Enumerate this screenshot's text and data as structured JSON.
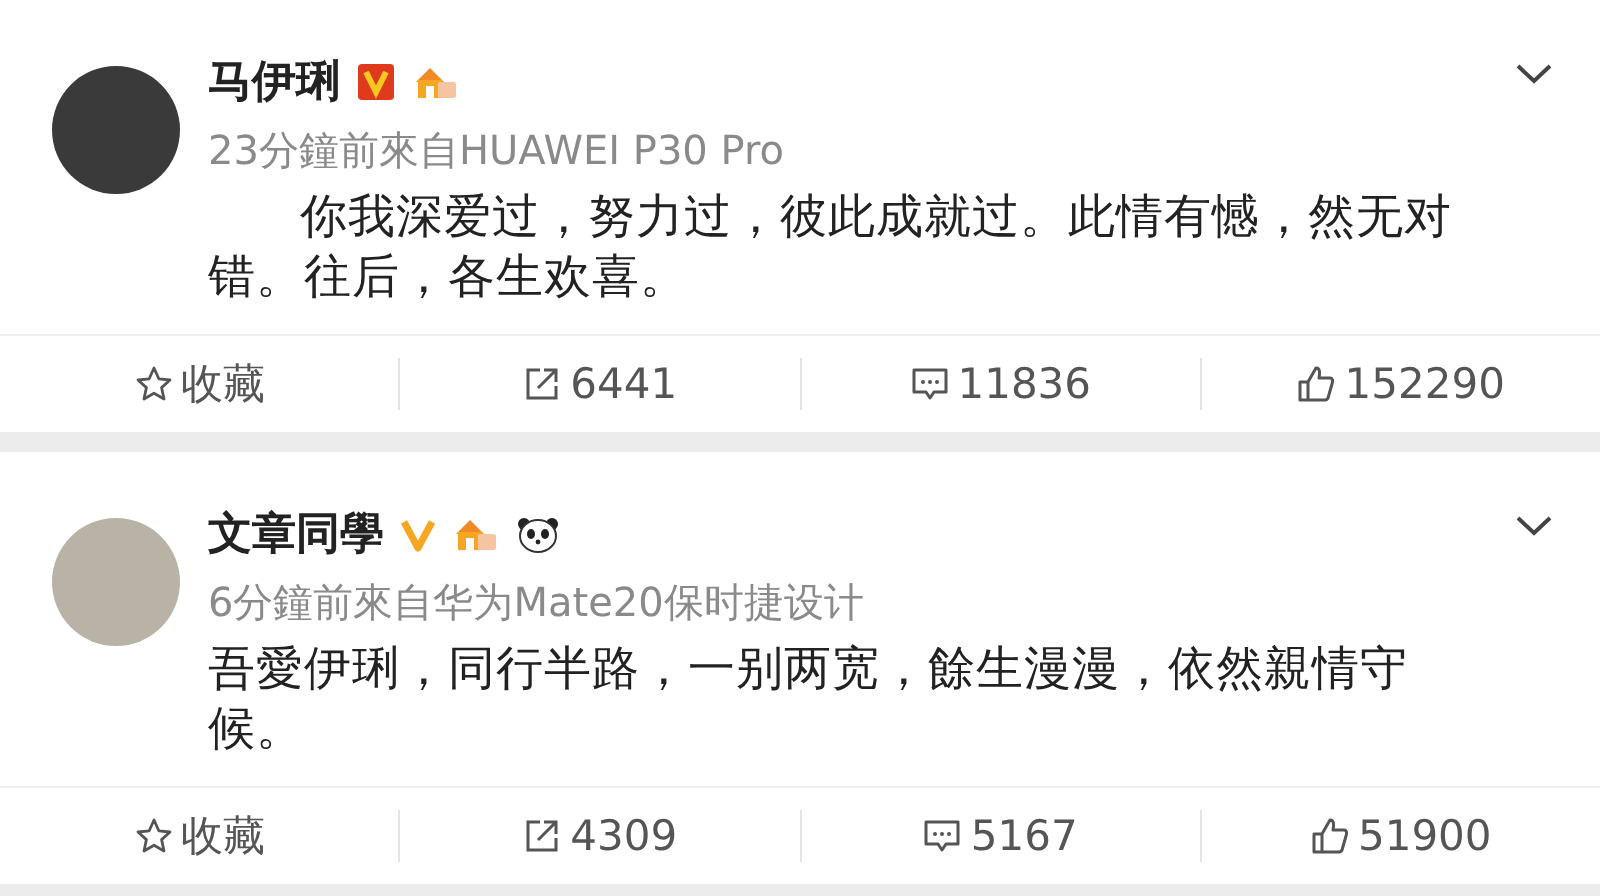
{
  "posts": [
    {
      "author": "马伊琍",
      "badges": [
        {
          "kind": "verified-box"
        },
        {
          "kind": "house"
        }
      ],
      "meta": "23分鐘前來自HUAWEI P30 Pro",
      "indent": true,
      "text": "你我深爱过，努力过，彼此成就过。此情有憾，然无对错。往后，各生欢喜。",
      "actions": [
        {
          "kind": "favorite",
          "label": "收藏"
        },
        {
          "kind": "repost",
          "label": "6441"
        },
        {
          "kind": "comment",
          "label": "11836"
        },
        {
          "kind": "like",
          "label": "152290"
        }
      ]
    },
    {
      "author": "文章同學",
      "badges": [
        {
          "kind": "verified"
        },
        {
          "kind": "house"
        },
        {
          "kind": "panda"
        }
      ],
      "meta": "6分鐘前來自华为Mate20保时捷设计",
      "indent": false,
      "text": "吾愛伊琍，同行半路，一别两宽，餘生漫漫，依然親情守候。",
      "actions": [
        {
          "kind": "favorite",
          "label": "收藏"
        },
        {
          "kind": "repost",
          "label": "4309"
        },
        {
          "kind": "comment",
          "label": "5167"
        },
        {
          "kind": "like",
          "label": "51900"
        }
      ]
    }
  ]
}
